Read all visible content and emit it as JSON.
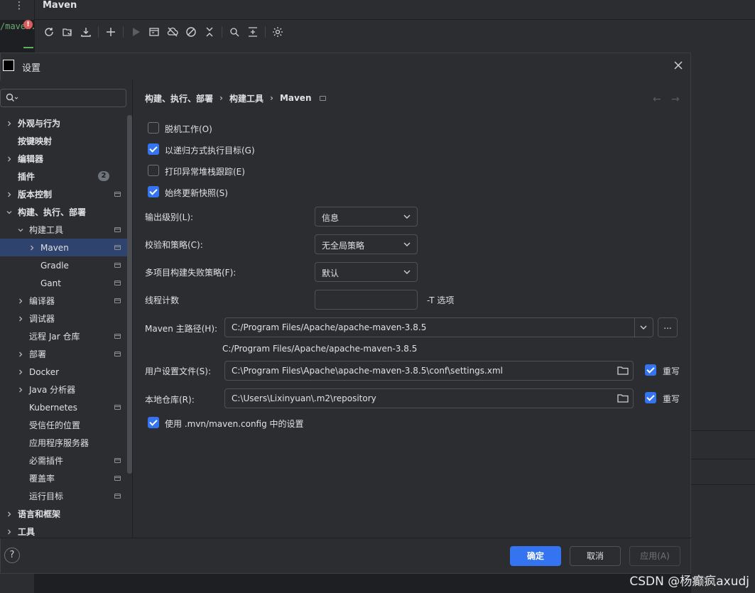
{
  "ide": {
    "code_snippet": "/maven.",
    "error_mark": "!",
    "menu_dots": "⋮",
    "maven_panel_title": "Maven"
  },
  "dialog": {
    "title": "设置",
    "search_placeholder": ""
  },
  "tree": [
    {
      "label": "外观与行为",
      "level": 0,
      "arrow": "right",
      "bold": true
    },
    {
      "label": "按键映射",
      "level": 0,
      "arrow": "",
      "bold": true
    },
    {
      "label": "编辑器",
      "level": 0,
      "arrow": "right",
      "bold": true
    },
    {
      "label": "插件",
      "level": 0,
      "arrow": "",
      "bold": true,
      "badge": "2"
    },
    {
      "label": "版本控制",
      "level": 0,
      "arrow": "right",
      "bold": true,
      "page": true
    },
    {
      "label": "构建、执行、部署",
      "level": 0,
      "arrow": "down",
      "bold": true
    },
    {
      "label": "构建工具",
      "level": 1,
      "arrow": "down",
      "page": true
    },
    {
      "label": "Maven",
      "level": 2,
      "arrow": "right",
      "page": true,
      "selected": true
    },
    {
      "label": "Gradle",
      "level": 2,
      "arrow": "",
      "page": true
    },
    {
      "label": "Gant",
      "level": 2,
      "arrow": "",
      "page": true
    },
    {
      "label": "编译器",
      "level": 1,
      "arrow": "right",
      "page": true
    },
    {
      "label": "调试器",
      "level": 1,
      "arrow": "right"
    },
    {
      "label": "远程 Jar 仓库",
      "level": 1,
      "arrow": "",
      "page": true
    },
    {
      "label": "部署",
      "level": 1,
      "arrow": "right",
      "page": true
    },
    {
      "label": "Docker",
      "level": 1,
      "arrow": "right"
    },
    {
      "label": "Java 分析器",
      "level": 1,
      "arrow": "right"
    },
    {
      "label": "Kubernetes",
      "level": 1,
      "arrow": "",
      "page": true
    },
    {
      "label": "受信任的位置",
      "level": 1,
      "arrow": ""
    },
    {
      "label": "应用程序服务器",
      "level": 1,
      "arrow": ""
    },
    {
      "label": "必需插件",
      "level": 1,
      "arrow": "",
      "page": true
    },
    {
      "label": "覆盖率",
      "level": 1,
      "arrow": "",
      "page": true
    },
    {
      "label": "运行目标",
      "level": 1,
      "arrow": "",
      "page": true
    },
    {
      "label": "语言和框架",
      "level": 0,
      "arrow": "right",
      "bold": true
    },
    {
      "label": "工具",
      "level": 0,
      "arrow": "right",
      "bold": true
    }
  ],
  "breadcrumb": [
    "构建、执行、部署",
    "构建工具",
    "Maven"
  ],
  "nav": {
    "back": "←",
    "forward": "→"
  },
  "checkboxes": [
    {
      "label": "脱机工作(O)",
      "checked": false
    },
    {
      "label": "以递归方式执行目标(G)",
      "checked": true
    },
    {
      "label": "打印异常堆栈跟踪(E)",
      "checked": false
    },
    {
      "label": "始终更新快照(S)",
      "checked": true
    }
  ],
  "output_level": {
    "label": "输出级别(L):",
    "value": "信息"
  },
  "checksum_policy": {
    "label": "校验和策略(C):",
    "value": "无全局策略"
  },
  "multiproject_fail": {
    "label": "多项目构建失败策略(F):",
    "value": "默认"
  },
  "thread_count": {
    "label": "线程计数",
    "value": "",
    "suffix": "-T 选项"
  },
  "maven_home": {
    "label": "Maven 主路径(H):",
    "value": "C:/Program Files/Apache/apache-maven-3.8.5",
    "hint": "C:/Program Files/Apache/apache-maven-3.8.5",
    "browse": "..."
  },
  "user_settings": {
    "label": "用户设置文件(S):",
    "value": "C:\\Program Files\\Apache\\apache-maven-3.8.5\\conf\\settings.xml",
    "override_label": "重写",
    "override": true
  },
  "local_repo": {
    "label": "本地仓库(R):",
    "value": "C:\\Users\\Lixinyuan\\.m2\\repository",
    "override_label": "重写",
    "override": true
  },
  "use_mvn_config": {
    "label": "使用 .mvn/maven.config 中的设置",
    "checked": true
  },
  "footer": {
    "help": "?",
    "ok": "确定",
    "cancel": "取消",
    "apply": "应用(A)"
  },
  "watermark": "CSDN @杨癫疯axudj",
  "colors": {
    "accent": "#3574f0",
    "panel": "#2b2d30",
    "selected": "#2e436e"
  }
}
